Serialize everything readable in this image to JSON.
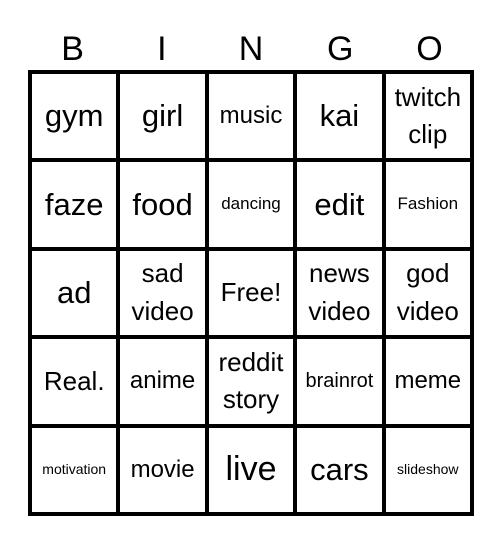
{
  "header": {
    "letters": [
      "B",
      "I",
      "N",
      "G",
      "O"
    ]
  },
  "cells": [
    [
      "gym",
      "girl",
      "music",
      "kai",
      "twitch clip"
    ],
    [
      "faze",
      "food",
      "dancing",
      "edit",
      "Fashion"
    ],
    [
      "ad",
      "sad video",
      "Free!",
      "news video",
      "god video"
    ],
    [
      "Real.",
      "anime",
      "reddit story",
      "brainrot",
      "meme"
    ],
    [
      "motivation",
      "movie",
      "live",
      "cars",
      "slideshow"
    ]
  ],
  "free_space": {
    "row": 2,
    "col": 2,
    "label": "Free!"
  }
}
